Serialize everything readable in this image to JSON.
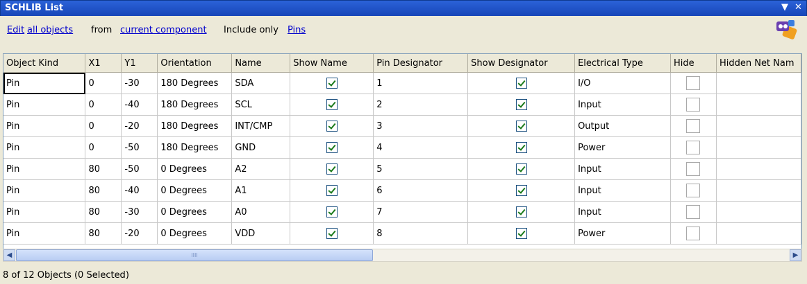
{
  "window": {
    "title": "SCHLIB List",
    "menu_glyph": "▼",
    "close_glyph": "✕"
  },
  "toolbar": {
    "edit": "Edit",
    "scope": "all objects",
    "from": "from",
    "source": "current component",
    "include": "Include only",
    "filter": "Pins",
    "logo_icon": "list-filter-icon"
  },
  "table": {
    "columns": [
      "Object Kind",
      "X1",
      "Y1",
      "Orientation",
      "Name",
      "Show Name",
      "Pin Designator",
      "Show Designator",
      "Electrical Type",
      "Hide",
      "Hidden Net Nam"
    ],
    "rows": [
      {
        "kind": "Pin",
        "x1": "0",
        "y1": "-30",
        "orientation": "180 Degrees",
        "name": "SDA",
        "show_name": true,
        "designator": "1",
        "show_designator": true,
        "etype": "I/O",
        "hide": false,
        "hidden_net": ""
      },
      {
        "kind": "Pin",
        "x1": "0",
        "y1": "-40",
        "orientation": "180 Degrees",
        "name": "SCL",
        "show_name": true,
        "designator": "2",
        "show_designator": true,
        "etype": "Input",
        "hide": false,
        "hidden_net": ""
      },
      {
        "kind": "Pin",
        "x1": "0",
        "y1": "-20",
        "orientation": "180 Degrees",
        "name": "INT/CMP",
        "show_name": true,
        "designator": "3",
        "show_designator": true,
        "etype": "Output",
        "hide": false,
        "hidden_net": ""
      },
      {
        "kind": "Pin",
        "x1": "0",
        "y1": "-50",
        "orientation": "180 Degrees",
        "name": "GND",
        "show_name": true,
        "designator": "4",
        "show_designator": true,
        "etype": "Power",
        "hide": false,
        "hidden_net": ""
      },
      {
        "kind": "Pin",
        "x1": "80",
        "y1": "-50",
        "orientation": "0 Degrees",
        "name": "A2",
        "show_name": true,
        "designator": "5",
        "show_designator": true,
        "etype": "Input",
        "hide": false,
        "hidden_net": ""
      },
      {
        "kind": "Pin",
        "x1": "80",
        "y1": "-40",
        "orientation": "0 Degrees",
        "name": "A1",
        "show_name": true,
        "designator": "6",
        "show_designator": true,
        "etype": "Input",
        "hide": false,
        "hidden_net": ""
      },
      {
        "kind": "Pin",
        "x1": "80",
        "y1": "-30",
        "orientation": "0 Degrees",
        "name": "A0",
        "show_name": true,
        "designator": "7",
        "show_designator": true,
        "etype": "Input",
        "hide": false,
        "hidden_net": ""
      },
      {
        "kind": "Pin",
        "x1": "80",
        "y1": "-20",
        "orientation": "0 Degrees",
        "name": "VDD",
        "show_name": true,
        "designator": "8",
        "show_designator": true,
        "etype": "Power",
        "hide": false,
        "hidden_net": ""
      }
    ]
  },
  "scrollbar": {
    "left_glyph": "◀",
    "right_glyph": "▶",
    "grip": "IIII"
  },
  "status": {
    "text": "8 of 12 Objects (0 Selected)"
  }
}
